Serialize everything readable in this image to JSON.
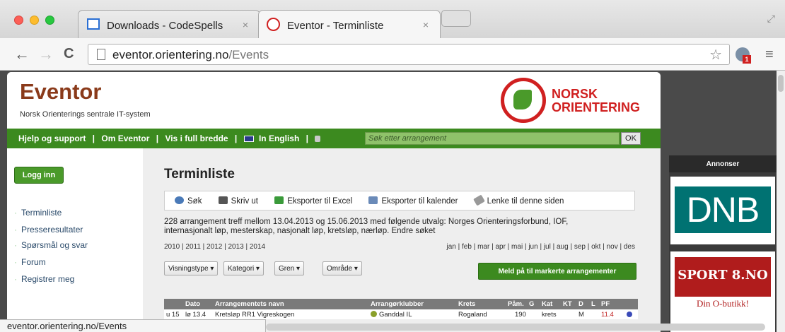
{
  "browser": {
    "tabs": [
      {
        "title": "Downloads - CodeSpells",
        "close": "×"
      },
      {
        "title": "Eventor - Terminliste",
        "close": "×"
      }
    ],
    "url_host": "eventor.orientering.no",
    "url_path": "/Events",
    "status_url": "eventor.orientering.no/Events",
    "ext_badge": "1"
  },
  "header": {
    "brand": "Eventor",
    "subtitle": "Norsk Orienterings sentrale IT-system",
    "logo_line1": "NORSK",
    "logo_line2": "ORIENTERING"
  },
  "greenbar": {
    "help": "Hjelp og support",
    "about": "Om Eventor",
    "wide": "Vis i full bredde",
    "english": "In English",
    "search_placeholder": "Søk etter arrangement",
    "ok": "OK"
  },
  "sidebar": {
    "login": "Logg inn",
    "items": [
      "Terminliste",
      "Presseresultater",
      "Spørsmål og svar",
      "Forum",
      "Registrer meg"
    ]
  },
  "main": {
    "title": "Terminliste",
    "actions": [
      "Søk",
      "Skriv ut",
      "Eksporter til Excel",
      "Eksporter til kalender",
      "Lenke til denne siden"
    ],
    "summary": "228 arrangement treff mellom 13.04.2013 og 15.06.2013 med følgende utvalg: Norges Orienteringsforbund, IOF, internasjonalt løp, mesterskap, nasjonalt løp, kretsløp, nærløp. Endre søket",
    "years": "2010 | 2011 | 2012 | 2013 | 2014",
    "months": "jan | feb | mar | apr | mai | jun | jul | aug | sep | okt | nov | des",
    "filters": [
      "Visningstype",
      "Kategori",
      "Gren",
      "Område"
    ],
    "meld": "Meld på til markerte arrangementer",
    "table": {
      "headers": [
        "Dato",
        "Arrangementets navn",
        "Arrangørklubber",
        "Krets",
        "Påm.",
        "G",
        "Kat",
        "KT",
        "D",
        "L",
        "PF"
      ],
      "row": [
        "u 15",
        "lø 13.4",
        "Kretsløp RR1 Vigreskogen",
        "Ganddal IL",
        "Rogaland",
        "190",
        "krets",
        "M",
        "11.4"
      ]
    }
  },
  "ads": {
    "title": "Annonser",
    "dnb": "DNB",
    "sport": "SPORT 8.NO",
    "sport_sub": "Din O-butikk!"
  },
  "colors": {
    "green": "#3c8a1f",
    "brand": "#8a3a1a",
    "logo_red": "#d02020",
    "dnb": "#007272"
  }
}
